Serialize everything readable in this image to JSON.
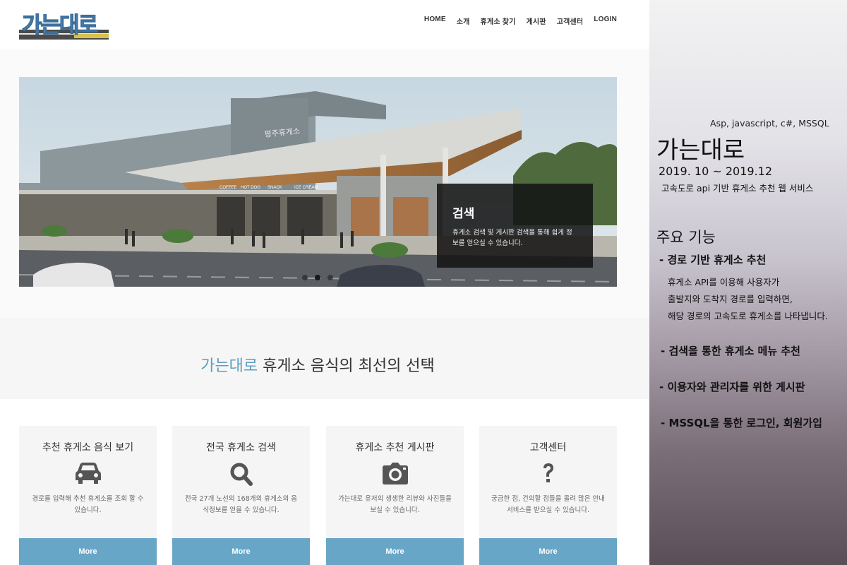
{
  "header": {
    "logo_text": "가는대로",
    "nav": [
      "HOME",
      "소개",
      "휴게소 찾기",
      "게시판",
      "고객센터",
      "LOGIN"
    ]
  },
  "hero": {
    "caption_title": "검색",
    "caption_text": "휴게소 검색 및 게시판 검색을 통해 쉽게 정보를 얻으실 수 있습니다.",
    "building_sign": "평주휴게소",
    "shop_signs": [
      "COFFEE",
      "HOT DOG",
      "SNACK",
      "ICE CREAM"
    ],
    "slide_count": 3,
    "active_slide": 2
  },
  "tagline": {
    "brand": "가는대로",
    "text": " 휴게소 음식의 최선의 선택"
  },
  "cards": [
    {
      "title": "추천 휴게소 음식 보기",
      "icon": "car-icon",
      "desc": "경로를 입력해 추천 휴게소를 조회 할 수 있습니다.",
      "button": "More"
    },
    {
      "title": "전국 휴게소 검색",
      "icon": "search-icon",
      "desc": "전국 27개 노선의 168개의 휴게소의 음식정보를 얻을 수 있습니다.",
      "button": "More"
    },
    {
      "title": "휴게소 추천 게시판",
      "icon": "camera-icon",
      "desc": "가는대로 유저의 생생한 리뷰와 사진들을 보실 수 있습니다.",
      "button": "More"
    },
    {
      "title": "고객센터",
      "icon": "question-icon",
      "desc": "궁금한 점, 건의할 점들을 올려 많은 안내 서비스를 받으실 수 있습니다.",
      "button": "More"
    }
  ],
  "panel": {
    "tech": "Asp, javascript, c#, MSSQL",
    "title": "가는대로",
    "period": "2019. 10 ~ 2019.12",
    "summary": "고속도로 api 기반 휴게소 추천 웹 서비스",
    "features_heading": "주요 기능",
    "features": [
      "- 경로 기반 휴게소 추천",
      "- 검색을 통한 휴게소 메뉴 추천",
      "- 이용자와 관리자를 위한 게시판",
      "- MSSQL을 통한 로그인, 회원가입"
    ],
    "feature1_desc": [
      "휴게소 API를 이용해 사용자가",
      "출발지와 도착지 경로를 입력하면,",
      "해당 경로의 고속도로 휴게소를 나타냅니다."
    ]
  },
  "colors": {
    "accent": "#68a6c7",
    "brand_text": "#5b9ec4",
    "caption_bg": "#141414"
  }
}
